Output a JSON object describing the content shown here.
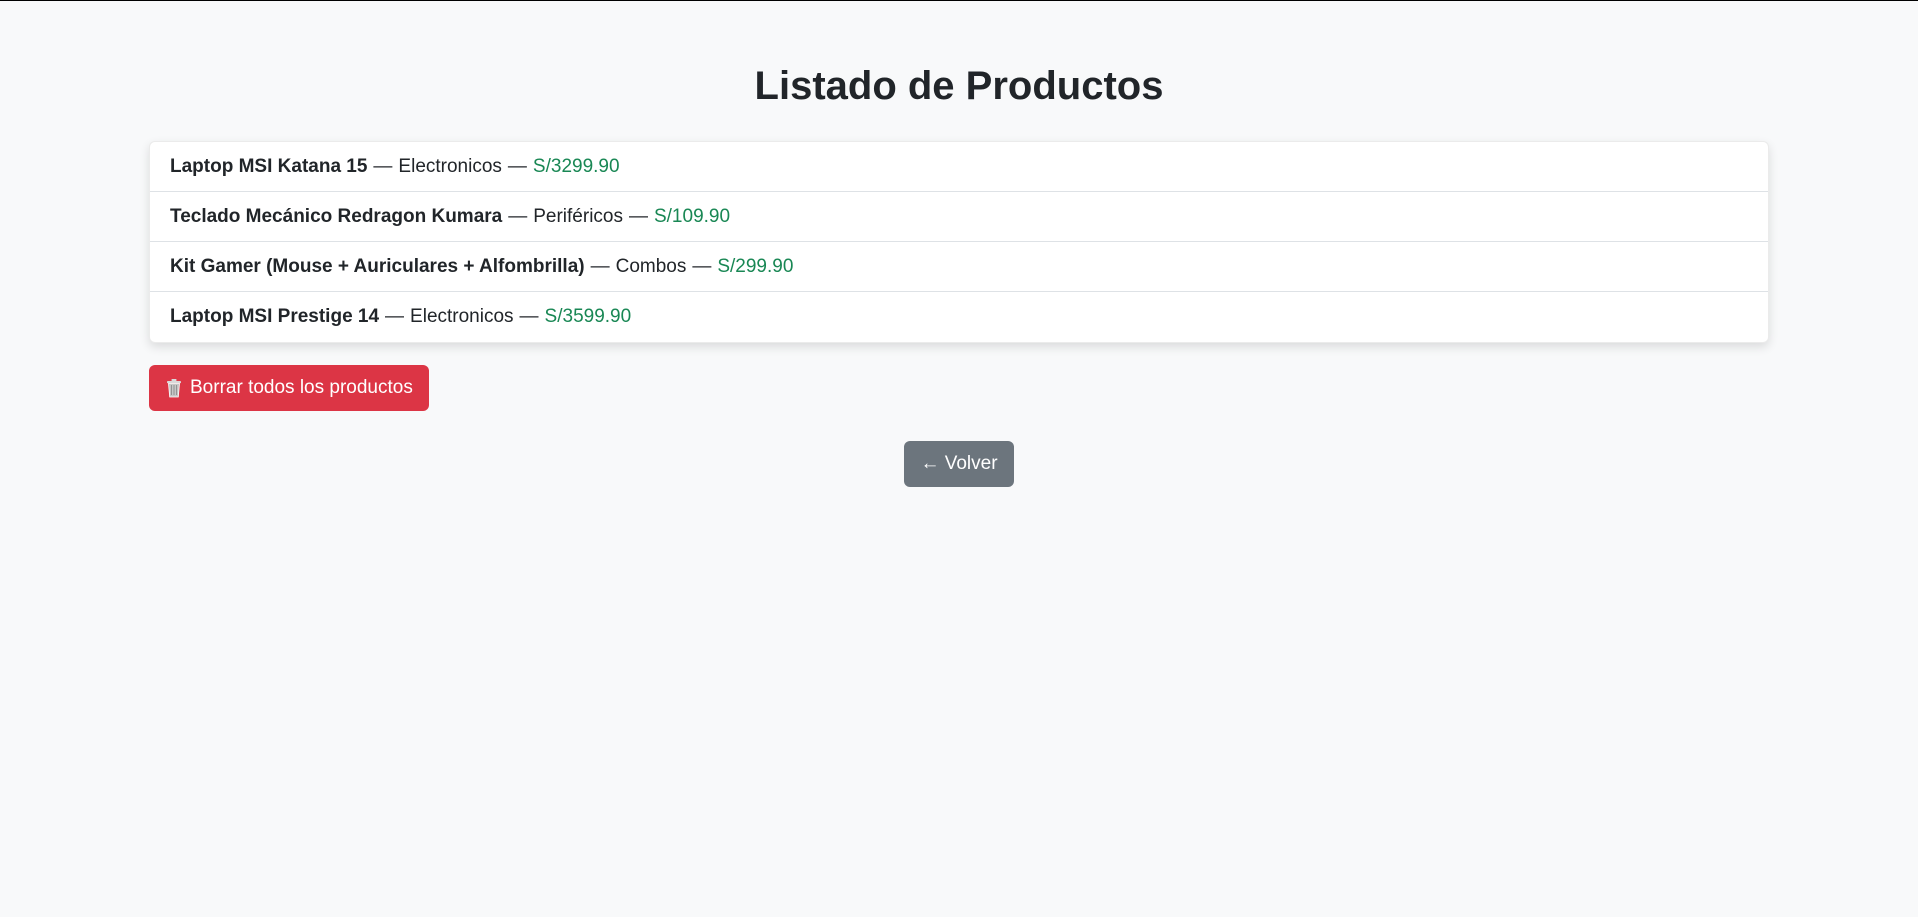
{
  "page": {
    "title": "Listado de Productos"
  },
  "products": [
    {
      "name": "Laptop MSI Katana 15",
      "separator": "—",
      "category": "Electronicos",
      "price": "S/3299.90"
    },
    {
      "name": "Teclado Mecánico Redragon Kumara",
      "separator": "—",
      "category": "Periféricos",
      "price": "S/109.90"
    },
    {
      "name": "Kit Gamer (Mouse + Auriculares + Alfombrilla)",
      "separator": "—",
      "category": "Combos",
      "price": "S/299.90"
    },
    {
      "name": "Laptop MSI Prestige 14",
      "separator": "—",
      "category": "Electronicos",
      "price": "S/3599.90"
    }
  ],
  "actions": {
    "delete_all_icon": "trash-icon",
    "delete_all_label": "Borrar todos los productos",
    "back_label": "← Volver"
  },
  "colors": {
    "background": "#f8f9fa",
    "price": "#198754",
    "danger": "#dc3545",
    "secondary": "#6c757d"
  }
}
